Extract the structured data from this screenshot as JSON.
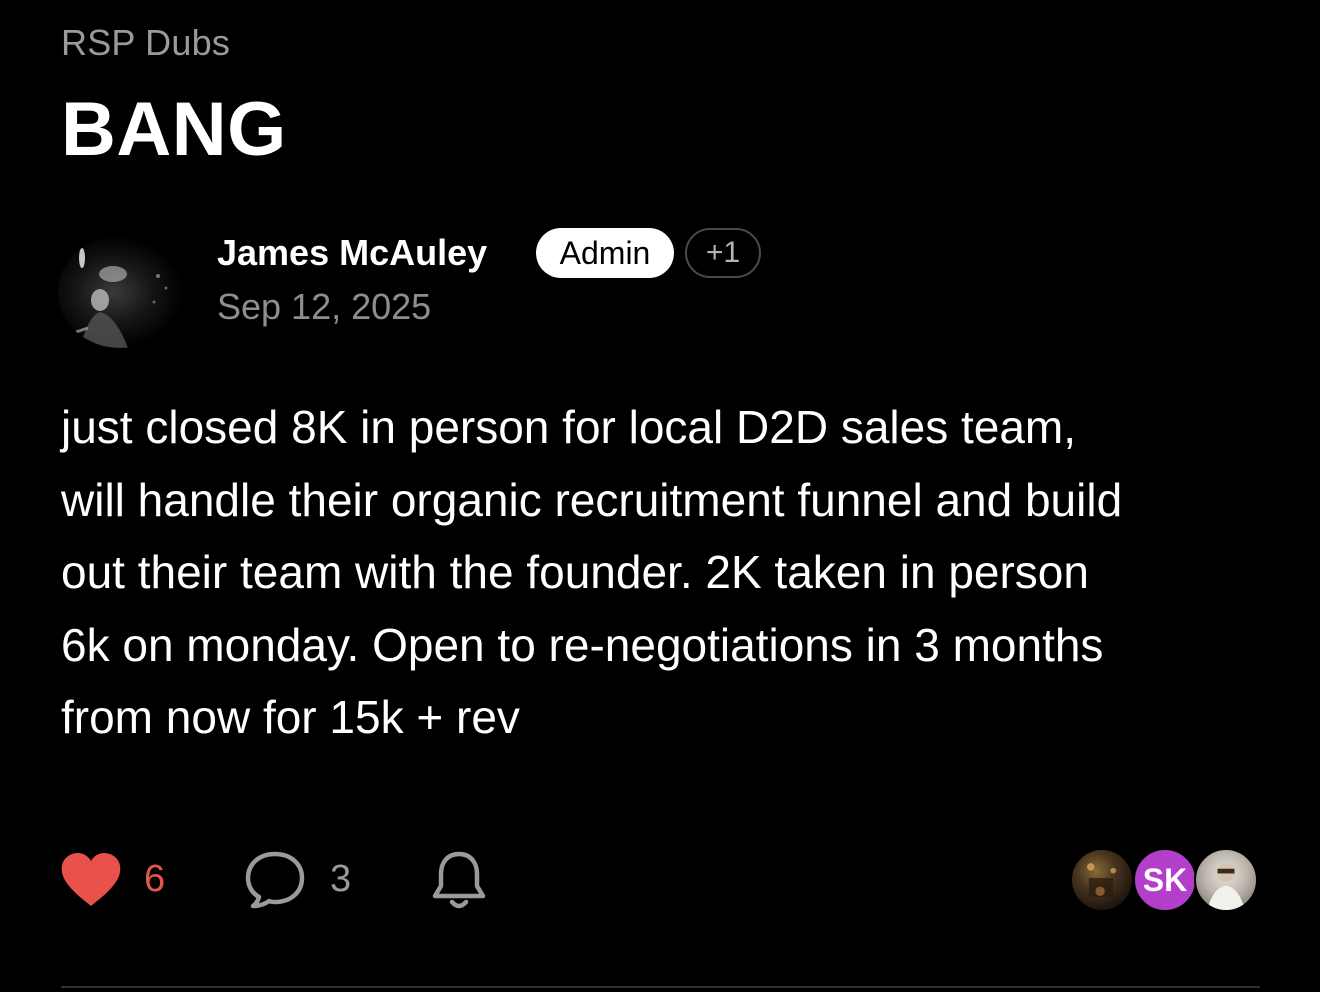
{
  "post": {
    "community": "RSP Dubs",
    "title": "BANG",
    "author": {
      "name": "James McAuley",
      "role_badge": "Admin",
      "extra_badge": "+1",
      "date": "Sep 12, 2025"
    },
    "body": "just closed 8K in person for local D2D sales team,\nwill handle their organic recruitment funnel and build\nout their team with the founder. 2K taken in person\n6k on monday. Open to re-negotiations in 3 months\nfrom now for 15k + rev"
  },
  "actions": {
    "like": {
      "icon": "heart-icon",
      "count": "6",
      "color": "#e8524a"
    },
    "comment": {
      "icon": "comment-bubble-icon",
      "count": "3"
    },
    "notify": {
      "icon": "bell-icon"
    }
  },
  "participants": [
    {
      "type": "photo"
    },
    {
      "type": "initials",
      "initials": "SK",
      "color": "#b23ec9"
    },
    {
      "type": "photo"
    }
  ]
}
